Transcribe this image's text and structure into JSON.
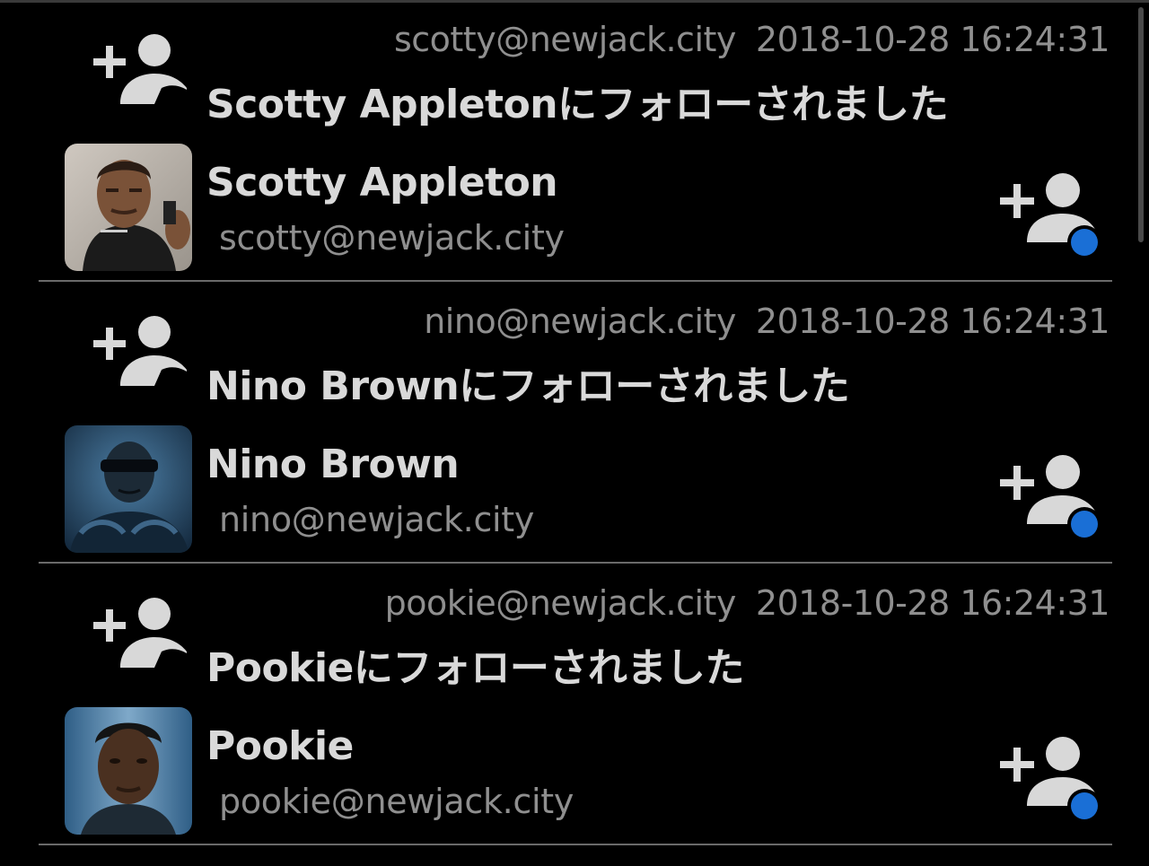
{
  "colors": {
    "background": "#000000",
    "primary_text": "#d9d9d9",
    "secondary_text": "#8f8f8f",
    "icon": "#d8d8d8",
    "accent_badge": "#1a6fd6",
    "divider": "#6a6a6a"
  },
  "notifications": [
    {
      "type": "follow",
      "icon": "person-add-icon",
      "acct": "scotty@newjack.city",
      "timestamp": "2018-10-28 16:24:31",
      "headline_name": "Scotty Appleton",
      "headline_suffix": "にフォローされました",
      "account": {
        "display_name": "Scotty Appleton",
        "acct": "scotty@newjack.city",
        "avatar_alt": "Scotty Appleton avatar"
      },
      "follow_button_icon": "person-add-icon"
    },
    {
      "type": "follow",
      "icon": "person-add-icon",
      "acct": "nino@newjack.city",
      "timestamp": "2018-10-28 16:24:31",
      "headline_name": "Nino Brown",
      "headline_suffix": "にフォローされました",
      "account": {
        "display_name": "Nino Brown",
        "acct": "nino@newjack.city",
        "avatar_alt": "Nino Brown avatar"
      },
      "follow_button_icon": "person-add-icon"
    },
    {
      "type": "follow",
      "icon": "person-add-icon",
      "acct": "pookie@newjack.city",
      "timestamp": "2018-10-28 16:24:31",
      "headline_name": "Pookie",
      "headline_suffix": "にフォローされました",
      "account": {
        "display_name": "Pookie",
        "acct": "pookie@newjack.city",
        "avatar_alt": "Pookie avatar"
      },
      "follow_button_icon": "person-add-icon"
    }
  ]
}
